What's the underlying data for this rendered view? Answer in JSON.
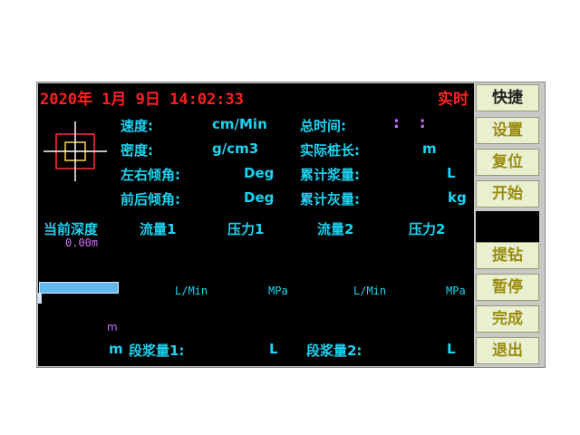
{
  "header": {
    "datetime": "2020年 1月 9日 14:02:33",
    "mode": "实时"
  },
  "params": {
    "speed_label": "速度:",
    "speed_unit": "cm/Min",
    "total_time_label": "总时间:",
    "total_time_value": ":   :",
    "density_label": "密度:",
    "density_unit": "g/cm3",
    "pile_length_label": "实际桩长:",
    "pile_length_unit": "m",
    "lr_tilt_label": "左右倾角:",
    "lr_tilt_unit": "Deg",
    "cum_slurry_label": "累计浆量:",
    "cum_slurry_unit": "L",
    "fb_tilt_label": "前后倾角:",
    "fb_tilt_unit": "Deg",
    "cum_ash_label": "累计灰量:",
    "cum_ash_unit": "kg"
  },
  "depth": {
    "label": "当前深度",
    "value": "0.00m",
    "bar_fill_fraction": 1.0,
    "unit_top": "m",
    "unit_bottom": "m"
  },
  "channels": {
    "flow1_label": "流量1",
    "pressure1_label": "压力1",
    "flow2_label": "流量2",
    "pressure2_label": "压力2",
    "flow1_unit": "L/Min",
    "pressure1_unit": "MPa",
    "flow2_unit": "L/Min",
    "pressure2_unit": "MPa"
  },
  "segments": {
    "seg1_label": "段浆量1:",
    "seg1_unit": "L",
    "seg2_label": "段浆量2:",
    "seg2_unit": "L"
  },
  "buttons": {
    "shortcut": "快捷",
    "settings": "设置",
    "reset": "复位",
    "start": "开始",
    "lift_drill": "提钻",
    "pause": "暂停",
    "finish": "完成",
    "exit": "退出"
  },
  "colors": {
    "panel_bg": "#000000",
    "header_red": "#ff2020",
    "label_cyan": "#19d4f2",
    "value_pink": "#d070ff",
    "button_bg": "#e8f0d0",
    "button_text_dark": "#202020",
    "button_text_olive": "#9a8c10",
    "crosshair_white": "#ffffff",
    "target_outer": "#ff3030",
    "target_inner": "#ffd24a"
  },
  "icons": {
    "target": "crosshair-target-icon"
  }
}
